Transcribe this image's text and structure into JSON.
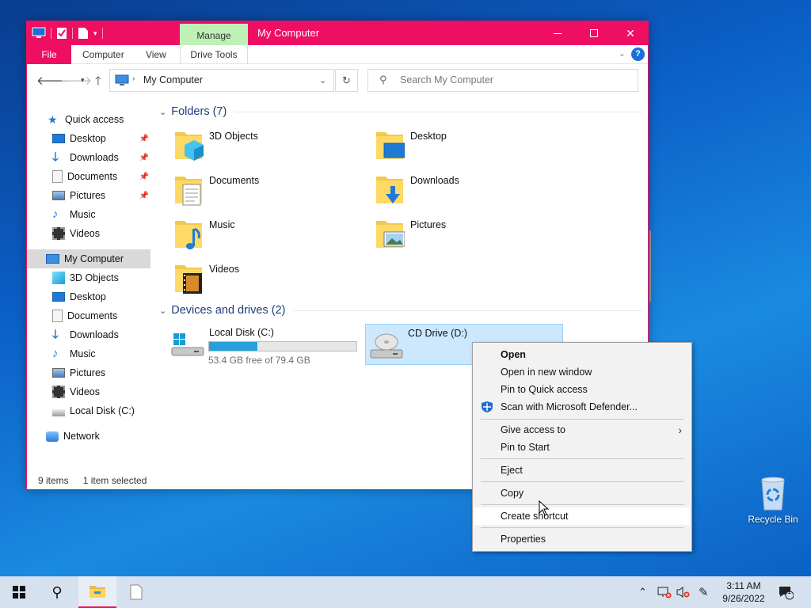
{
  "window": {
    "title": "My Computer",
    "manage_tab": "Manage",
    "ribbon_tabs": [
      "File",
      "Computer",
      "View",
      "Drive Tools"
    ],
    "controls": {
      "minimize": "—",
      "maximize": "☐",
      "close": "✕"
    }
  },
  "address": {
    "path": "My Computer",
    "search_placeholder": "Search My Computer"
  },
  "nav": {
    "quick_access": "Quick access",
    "quick_items": [
      "Desktop",
      "Downloads",
      "Documents",
      "Pictures",
      "Music",
      "Videos"
    ],
    "computer": "My Computer",
    "computer_items": [
      "3D Objects",
      "Desktop",
      "Documents",
      "Downloads",
      "Music",
      "Pictures",
      "Videos",
      "Local Disk (C:)"
    ],
    "network": "Network"
  },
  "content": {
    "folders_header": "Folders (7)",
    "folders": [
      "3D Objects",
      "Desktop",
      "Documents",
      "Downloads",
      "Music",
      "Pictures",
      "Videos"
    ],
    "drives_header": "Devices and drives (2)",
    "drive_c": {
      "label": "Local Disk (C:)",
      "free": "53.4 GB free of 79.4 GB",
      "used_fraction": 0.327
    },
    "drive_d": {
      "label": "CD Drive (D:)"
    }
  },
  "status": {
    "items": "9 items",
    "selected": "1 item selected"
  },
  "context_menu": {
    "open": "Open",
    "open_new_window": "Open in new window",
    "pin_quick": "Pin to Quick access",
    "scan": "Scan with Microsoft Defender...",
    "give_access": "Give access to",
    "pin_start": "Pin to Start",
    "eject": "Eject",
    "copy": "Copy",
    "create_shortcut": "Create shortcut",
    "properties": "Properties"
  },
  "desktop": {
    "recycle_bin": "Recycle Bin"
  },
  "taskbar": {
    "time": "3:11 AM",
    "date": "9/26/2022",
    "notifications": "1"
  },
  "colors": {
    "accent": "#ee0f62",
    "manage_tab": "#bff0b7",
    "selection": "#cce8ff",
    "progress": "#26a0da"
  }
}
